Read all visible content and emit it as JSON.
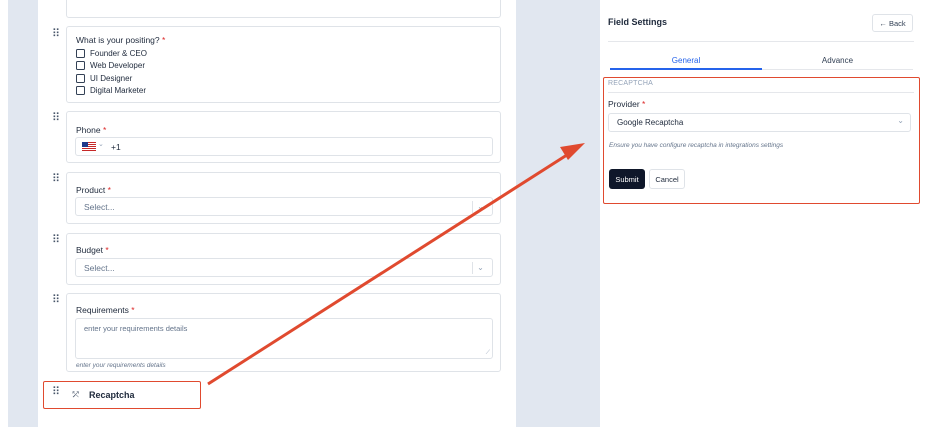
{
  "form": {
    "positing": {
      "label": "What is your positing?",
      "required_mark": "*",
      "options": [
        "Founder & CEO",
        "Web Developer",
        "UI Designer",
        "Digital Marketer"
      ]
    },
    "phone": {
      "label": "Phone",
      "required_mark": "*",
      "flag": "us-flag-icon",
      "dial_code": "+1",
      "chevron": "⌄"
    },
    "product": {
      "label": "Product",
      "required_mark": "*",
      "placeholder": "Select...",
      "caret": "⌄"
    },
    "budget": {
      "label": "Budget",
      "required_mark": "*",
      "placeholder": "Select...",
      "caret": "⌄"
    },
    "requirements": {
      "label": "Requirements",
      "required_mark": "*",
      "placeholder": "enter your requirements details",
      "help": "enter your requirements details"
    },
    "recaptcha": {
      "label": "Recaptcha",
      "icon": "recaptcha-icon"
    },
    "drag_handle_glyph": "⠿"
  },
  "settings": {
    "title": "Field Settings",
    "back_label": "← Back",
    "tabs": [
      "General",
      "Advance"
    ],
    "active_tab": "General",
    "section_title": "RECAPTCHA",
    "provider_label": "Provider",
    "provider_required_mark": "*",
    "provider_value": "Google Recaptcha",
    "provider_caret": "⌄",
    "provider_hint": "Ensure you have configure recaptcha in integrations settings",
    "submit_label": "Submit",
    "cancel_label": "Cancel"
  },
  "colors": {
    "accent": "#2563eb",
    "highlight_annotation": "#e04a2f",
    "required": "#dc2626",
    "background": "#e1e7f0"
  }
}
